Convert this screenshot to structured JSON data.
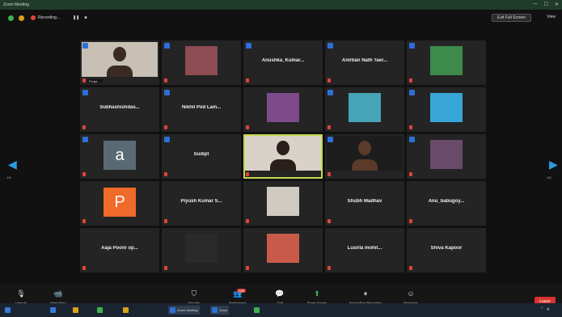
{
  "window": {
    "title": "Zoom Meeting"
  },
  "topbar": {
    "recording_label": "Recording...",
    "pause_label": "❚❚",
    "stop_label": "■",
    "gallery_button": "Exit Full Screen",
    "view_button": "View"
  },
  "nav": {
    "prev_page": "1/5",
    "next_page": "1/5"
  },
  "tiles": [
    {
      "type": "video",
      "label": "Pooja ... ",
      "bg": "#c8c0b4",
      "person": "#3a2a22"
    },
    {
      "type": "image",
      "label": "",
      "bg": "#8e4c55"
    },
    {
      "type": "name",
      "name": "Anushka_Kumar...",
      "label": ""
    },
    {
      "type": "name",
      "name": "Anirban Nath Taer...",
      "label": ""
    },
    {
      "type": "image",
      "label": "",
      "bg": "#3d8a4a"
    },
    {
      "type": "name",
      "name": "Subhashishdas...",
      "label": ""
    },
    {
      "type": "name",
      "name": "Nikhil Pod Lam...",
      "label": ""
    },
    {
      "type": "image",
      "label": "",
      "bg": "#7d4a8a"
    },
    {
      "type": "image",
      "label": "",
      "bg": "#46a4b8"
    },
    {
      "type": "image",
      "label": "",
      "bg": "#38a6d8"
    },
    {
      "type": "letter",
      "letter": "a",
      "label": "",
      "bg": "#5a6a74"
    },
    {
      "type": "name",
      "name": "Sudipt",
      "label": ""
    },
    {
      "type": "video",
      "label": "",
      "bg": "#d9d2c8",
      "person": "#2a1f1a",
      "speaking": true
    },
    {
      "type": "video",
      "label": "",
      "bg": "#1d1d1d",
      "person": "#5a3a2a"
    },
    {
      "type": "image",
      "label": "",
      "bg": "#6a4a6a"
    },
    {
      "type": "letter",
      "letter": "P",
      "label": "",
      "bg": "#f06a2a"
    },
    {
      "type": "name",
      "name": "Piyush Kumar S...",
      "label": ""
    },
    {
      "type": "image",
      "label": "",
      "bg": "#cfcac2"
    },
    {
      "type": "name",
      "name": "Shubh Madhav",
      "label": ""
    },
    {
      "type": "name",
      "name": "Anu_babugoy...",
      "label": ""
    },
    {
      "type": "name",
      "name": "Aaja Poonr op...",
      "label": ""
    },
    {
      "type": "image",
      "label": "",
      "bg": "#2a2a2a"
    },
    {
      "type": "image",
      "label": "",
      "bg": "#c85a4a"
    },
    {
      "type": "name",
      "name": "Lusirla mohit...",
      "label": ""
    },
    {
      "type": "name",
      "name": "Shiva Kapoor",
      "label": ""
    }
  ],
  "toolbar": {
    "unmute": "Unmute",
    "start_video": "Start Video",
    "security": "Security",
    "participants": "Participants",
    "participants_count": "100",
    "chat": "Chat",
    "share_screen": "Share Screen",
    "pause_recording": "Pause/Stop Recording",
    "reactions": "Reactions",
    "end": "Leave"
  },
  "taskbar": {
    "items": [
      {
        "label": "",
        "color": "#3b78d8"
      },
      {
        "label": "",
        "color": "#d9a11a"
      },
      {
        "label": "",
        "color": "#3fb24f"
      },
      {
        "label": "",
        "color": "#d9a11a"
      },
      {
        "label": "Zoom Meeting",
        "color": "#2d6fd8"
      },
      {
        "label": "Zoom",
        "color": "#2d6fd8"
      },
      {
        "label": "",
        "color": "#3fb24f"
      }
    ],
    "time": "",
    "date": ""
  },
  "colors": {
    "accent": "#2d6fd8",
    "end": "#d8332c",
    "speaking": "#c7d84b"
  }
}
